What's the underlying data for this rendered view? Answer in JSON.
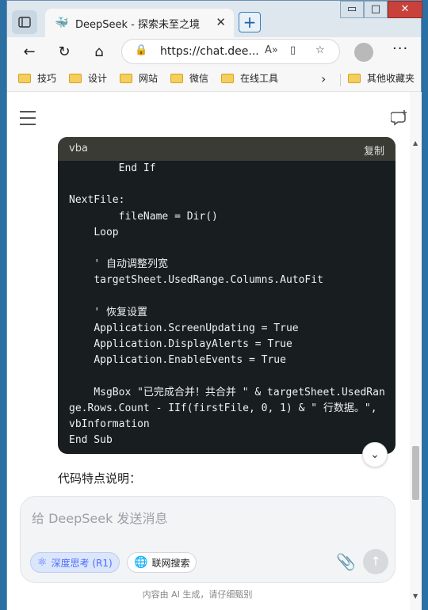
{
  "browser": {
    "tab_title": "DeepSeek - 探索未至之境",
    "url": "https://chat.dee...",
    "window_controls": {
      "minimize": "▭",
      "maximize": "□",
      "close": "✕"
    }
  },
  "bookmarks": {
    "items": [
      "技巧",
      "设计",
      "网站",
      "微信",
      "在线工具"
    ],
    "other": "其他收藏夹"
  },
  "code_block": {
    "language": "vba",
    "copy_label": "复制",
    "code": "        End If\n\nNextFile:\n        fileName = Dir()\n    Loop\n\n    ' 自动调整列宽\n    targetSheet.UsedRange.Columns.AutoFit\n\n    ' 恢复设置\n    Application.ScreenUpdating = True\n    Application.DisplayAlerts = True\n    Application.EnableEvents = True\n\n    MsgBox \"已完成合并！共合并 \" & targetSheet.UsedRange.Rows.Count - IIf(firstFile, 0, 1) & \" 行数据。\", vbInformation\nEnd Sub"
  },
  "content": {
    "features_heading": "代码特点说明："
  },
  "composer": {
    "placeholder": "给 DeepSeek 发送消息",
    "deep_think_label": "深度思考 (R1)",
    "web_search_label": "联网搜索"
  },
  "footer": {
    "disclaimer": "内容由 AI 生成，请仔细甄别"
  },
  "icons": [
    "sidebar-icon",
    "deepseek-logo-icon",
    "close-icon",
    "plus-icon",
    "back-icon",
    "refresh-icon",
    "home-icon",
    "lock-icon",
    "read-aloud-icon",
    "reader-icon",
    "favorite-add-icon",
    "profile-icon",
    "more-icon",
    "folder-icon",
    "chevron-right-icon",
    "menu-icon",
    "new-chat-icon",
    "chevron-down-icon",
    "atom-icon",
    "globe-icon",
    "paperclip-icon",
    "send-arrow-icon"
  ]
}
